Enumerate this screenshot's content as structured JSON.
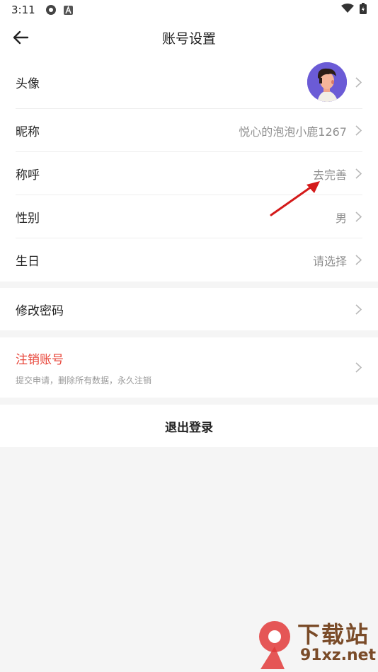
{
  "status_bar": {
    "time": "3:11",
    "icons": [
      "gear-icon",
      "a-icon",
      "wifi-icon",
      "battery-icon"
    ]
  },
  "header": {
    "title": "账号设置",
    "back_icon": "back-arrow-icon"
  },
  "profile_group": {
    "items": [
      {
        "label": "头像",
        "value": ""
      },
      {
        "label": "昵称",
        "value": "悦心的泡泡小鹿1267"
      },
      {
        "label": "称呼",
        "value": "去完善"
      },
      {
        "label": "性别",
        "value": "男"
      },
      {
        "label": "生日",
        "value": "请选择"
      }
    ]
  },
  "password_group": {
    "label": "修改密码"
  },
  "cancel_group": {
    "label": "注销账号",
    "sub": "提交申请，删除所有数据，永久注销"
  },
  "logout": {
    "label": "退出登录"
  },
  "watermark": {
    "line1": "下载站",
    "line2": "91xz.net"
  },
  "colors": {
    "accent_red": "#e8463a",
    "avatar_bg": "#6b5bd6",
    "annotation_arrow": "#d41a1a"
  }
}
